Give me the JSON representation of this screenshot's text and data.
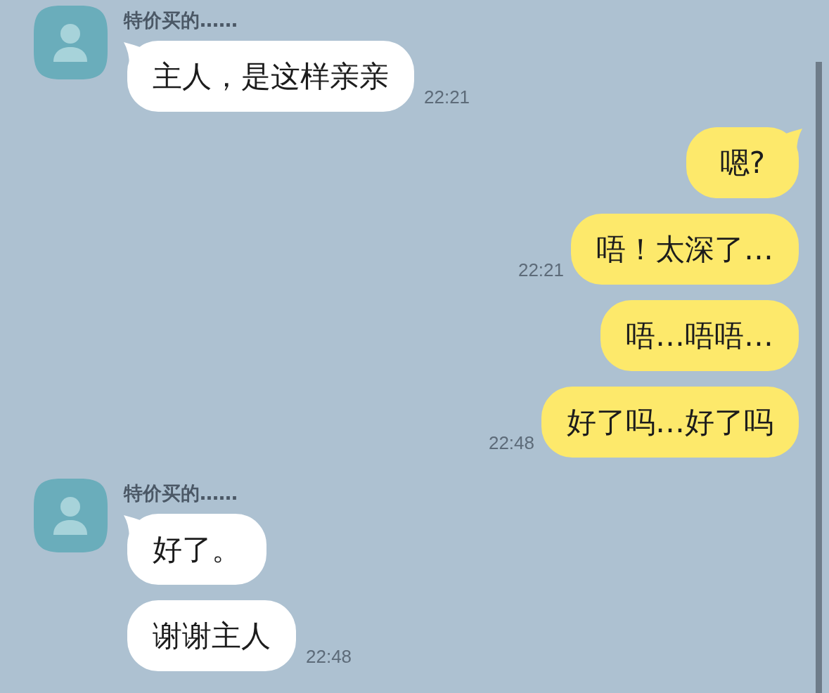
{
  "chat": {
    "groups": [
      {
        "kind": "received",
        "sender": "特价买的……",
        "messages": [
          {
            "text": "主人，是这样亲亲",
            "time": "22:21"
          }
        ]
      },
      {
        "kind": "sent",
        "messages": [
          {
            "text": "嗯?"
          },
          {
            "text": "唔！太深了…",
            "time": "22:21"
          },
          {
            "text": "唔…唔唔…"
          },
          {
            "text": "好了吗…好了吗",
            "time": "22:48"
          }
        ]
      },
      {
        "kind": "received",
        "sender": "特价买的……",
        "messages": [
          {
            "text": "好了。"
          },
          {
            "text": "谢谢主人",
            "time": "22:48"
          }
        ]
      }
    ]
  }
}
